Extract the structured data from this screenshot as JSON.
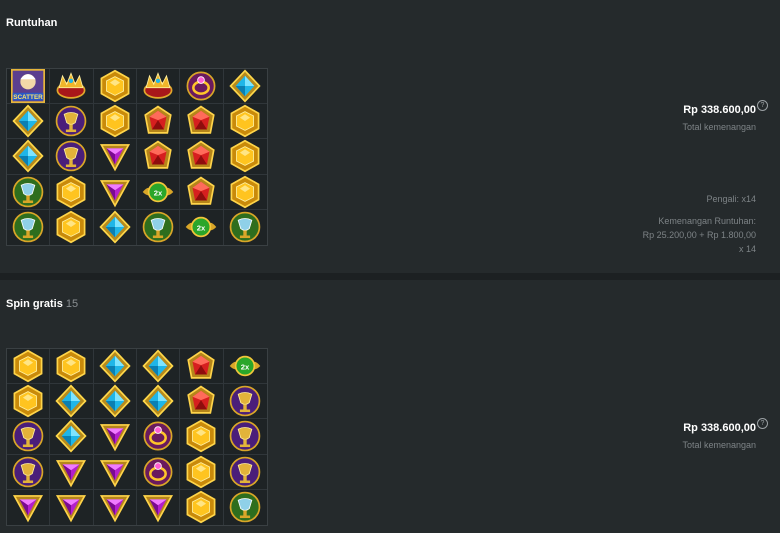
{
  "cascade": {
    "title": "Runtuhan",
    "total_win": "Rp 338.600,00",
    "total_win_label": "Total kemenangan",
    "multiplier": "Pengali: x14",
    "cascade_win_label": "Kemenangan Runtuhan:",
    "cascade_win_value": "Rp 25.200,00 + Rp 1.800,00",
    "cascade_win_mult": "x 14",
    "grid": [
      [
        "scatter",
        "crown",
        "gold-hexagon",
        "crown",
        "ring",
        "blue-gem"
      ],
      [
        "blue-gem",
        "purple-chalice",
        "gold-hexagon",
        "red-gem",
        "red-gem",
        "gold-hexagon"
      ],
      [
        "blue-gem",
        "purple-chalice",
        "purple-gem",
        "red-gem",
        "red-gem",
        "gold-hexagon"
      ],
      [
        "green-chalice",
        "gold-hexagon",
        "purple-gem",
        "multiplier-2x",
        "red-gem",
        "gold-hexagon"
      ],
      [
        "green-chalice",
        "gold-hexagon",
        "blue-gem",
        "green-chalice",
        "multiplier-2x",
        "green-chalice"
      ]
    ]
  },
  "free_spins": {
    "title": "Spin gratis",
    "count": "15",
    "total_win": "Rp 338.600,00",
    "total_win_label": "Total kemenangan",
    "grid": [
      [
        "gold-hexagon",
        "gold-hexagon",
        "blue-gem",
        "blue-gem",
        "red-gem",
        "multiplier-2x"
      ],
      [
        "gold-hexagon",
        "blue-gem",
        "blue-gem",
        "blue-gem",
        "red-gem",
        "purple-chalice"
      ],
      [
        "purple-chalice",
        "blue-gem",
        "purple-gem",
        "ring",
        "gold-hexagon",
        "purple-chalice"
      ],
      [
        "purple-chalice",
        "purple-gem",
        "purple-gem",
        "ring",
        "gold-hexagon",
        "purple-chalice"
      ],
      [
        "purple-gem",
        "purple-gem",
        "purple-gem",
        "purple-gem",
        "gold-hexagon",
        "green-chalice"
      ]
    ]
  },
  "symbols": {
    "scatter_text": "SCATTER",
    "multiplier_text": "2x"
  },
  "info_icon": "?"
}
